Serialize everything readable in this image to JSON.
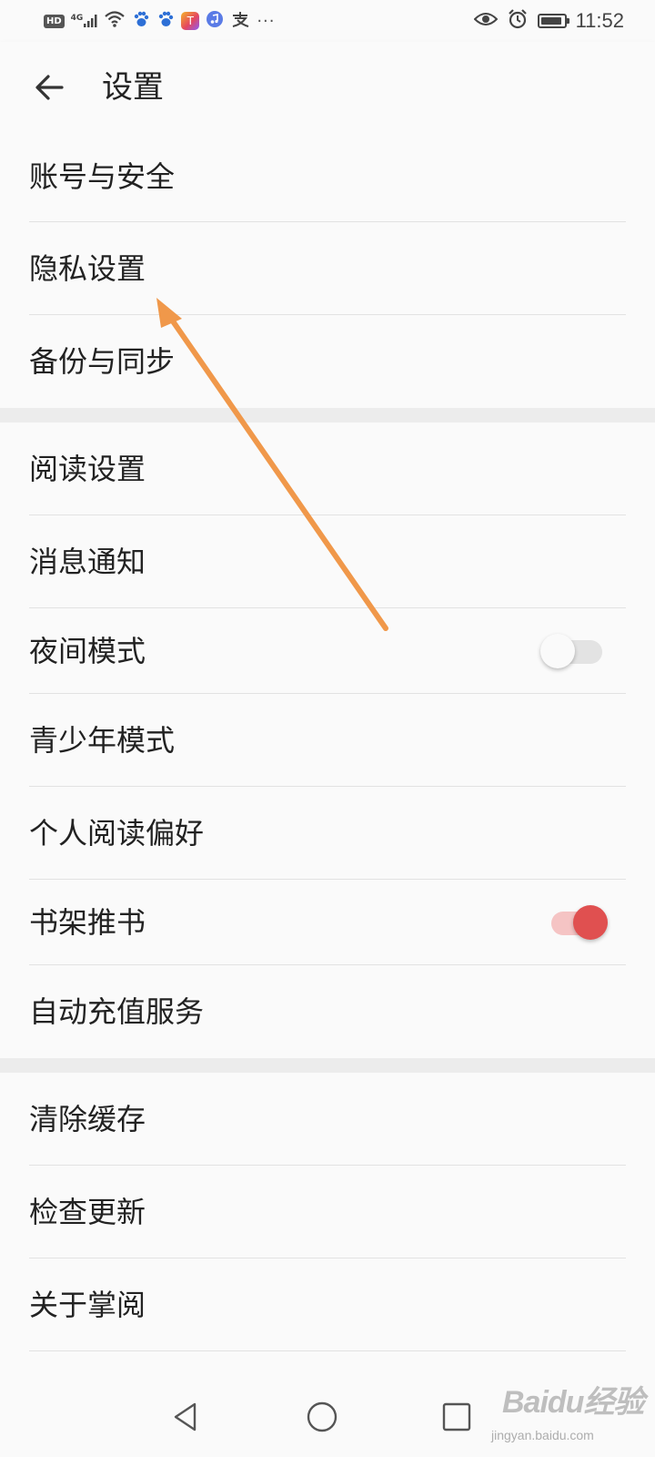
{
  "status_bar": {
    "hd": "HD",
    "network": "4G",
    "more": "···",
    "time": "11:52",
    "battery_level": 0.9,
    "icons": [
      "signal-icon",
      "wifi-icon",
      "baidu-paw-icon",
      "baidu-paw-icon",
      "app-t-icon",
      "music-icon",
      "zhi-icon",
      "eye-icon",
      "alarm-icon",
      "battery-icon"
    ]
  },
  "header": {
    "back_icon": "arrow-left-icon",
    "title": "设置"
  },
  "groups": [
    {
      "items": [
        {
          "label": "账号与安全"
        },
        {
          "label": "隐私设置"
        },
        {
          "label": "备份与同步"
        }
      ]
    },
    {
      "items": [
        {
          "label": "阅读设置"
        },
        {
          "label": "消息通知"
        },
        {
          "label": "夜间模式",
          "toggle": false
        },
        {
          "label": "青少年模式"
        },
        {
          "label": "个人阅读偏好"
        },
        {
          "label": "书架推书",
          "toggle": true
        },
        {
          "label": "自动充值服务"
        }
      ]
    },
    {
      "items": [
        {
          "label": "清除缓存"
        },
        {
          "label": "检查更新"
        },
        {
          "label": "关于掌阅"
        }
      ]
    }
  ],
  "nav_bar": {
    "icons": [
      "back-triangle-icon",
      "home-circle-icon",
      "recents-square-icon"
    ]
  },
  "colors": {
    "background": "#fafafa",
    "divider": "#e2e2e2",
    "group_gap": "#ececec",
    "toggle_on": "#e05050",
    "annotation_arrow": "#f0984a"
  },
  "watermark": {
    "logo": "Baidu经验",
    "url": "jingyan.baidu.com"
  }
}
